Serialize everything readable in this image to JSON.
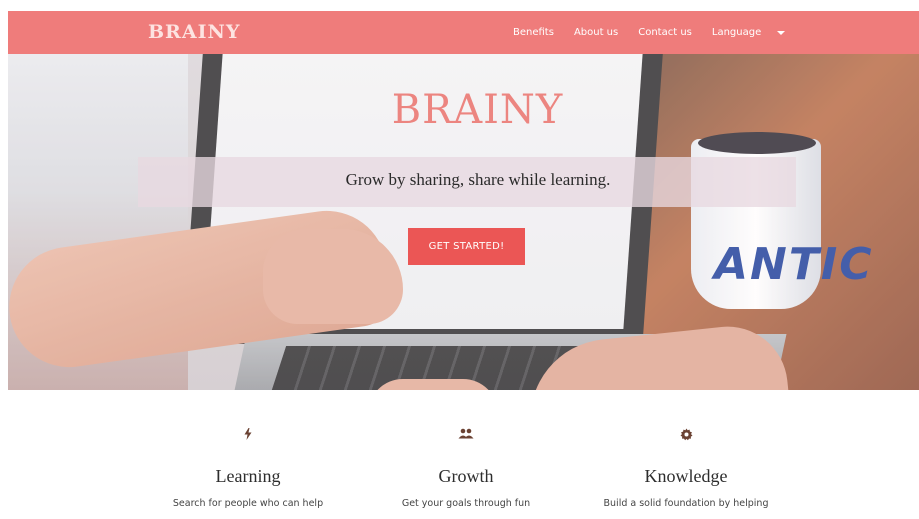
{
  "colors": {
    "nav_bg": "#ef7c7b",
    "brand_text": "#fde3e1",
    "cta_bg": "#eb5655",
    "hero_title": "#ec8580",
    "icon_color": "#6b4233"
  },
  "nav": {
    "brand": "BRAINY",
    "links": [
      {
        "label": "Benefits"
      },
      {
        "label": "About us"
      },
      {
        "label": "Contact us"
      }
    ],
    "language": {
      "label": "Language",
      "icon": "caret-down-icon"
    }
  },
  "hero": {
    "title": "BRAINY",
    "tagline": "Grow by sharing, share while learning.",
    "cta_label": "GET STARTED!"
  },
  "features": [
    {
      "icon": "bolt-icon",
      "title": "Learning",
      "text": "Search for people who can help"
    },
    {
      "icon": "people-icon",
      "title": "Growth",
      "text": "Get your goals through fun"
    },
    {
      "icon": "gear-icon",
      "title": "Knowledge",
      "text": "Build a solid foundation by helping"
    }
  ]
}
